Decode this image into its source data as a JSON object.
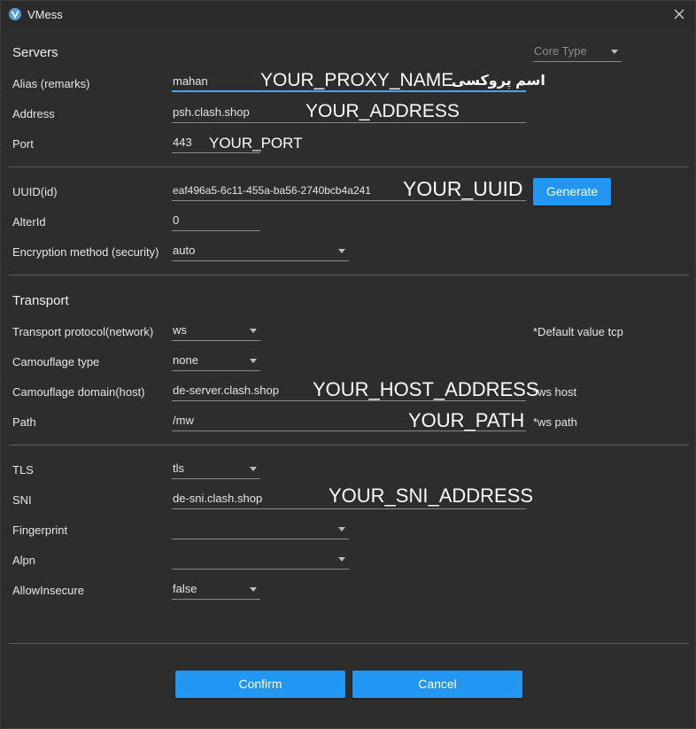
{
  "window": {
    "title": "VMess",
    "accent": "#2196f3",
    "background": "#2d2d2d"
  },
  "servers": {
    "section_title": "Servers",
    "core_type_placeholder": "Core Type",
    "alias_label": "Alias (remarks)",
    "alias_value": "mahan",
    "alias_overlay": "YOUR_PROXY_NAME",
    "alias_overlay_fa": "اسم پروکسی",
    "address_label": "Address",
    "address_value": "psh.clash.shop",
    "address_overlay": "YOUR_ADDRESS",
    "port_label": "Port",
    "port_value": "443",
    "port_overlay": "YOUR_PORT"
  },
  "account": {
    "uuid_label": "UUID(id)",
    "uuid_value": "eaf496a5-6c11-455a-ba56-2740bcb4a241",
    "uuid_overlay": "YOUR_UUID",
    "generate_label": "Generate",
    "alterid_label": "AlterId",
    "alterid_value": "0",
    "security_label": "Encryption method (security)",
    "security_value": "auto"
  },
  "transport": {
    "section_title": "Transport",
    "network_label": "Transport protocol(network)",
    "network_value": "ws",
    "network_hint": "*Default value tcp",
    "camouflage_type_label": "Camouflage type",
    "camouflage_type_value": "none",
    "host_label": "Camouflage domain(host)",
    "host_value": "de-server.clash.shop",
    "host_overlay": "YOUR_HOST_ADDRESS",
    "host_hint": "*ws host",
    "path_label": "Path",
    "path_value": "/mw",
    "path_overlay": "YOUR_PATH",
    "path_hint": "*ws path"
  },
  "tls": {
    "tls_label": "TLS",
    "tls_value": "tls",
    "sni_label": "SNI",
    "sni_value": "de-sni.clash.shop",
    "sni_overlay": "YOUR_SNI_ADDRESS",
    "fingerprint_label": "Fingerprint",
    "fingerprint_value": "",
    "alpn_label": "Alpn",
    "alpn_value": "",
    "allow_insecure_label": "AllowInsecure",
    "allow_insecure_value": "false"
  },
  "footer": {
    "confirm_label": "Confirm",
    "cancel_label": "Cancel"
  }
}
